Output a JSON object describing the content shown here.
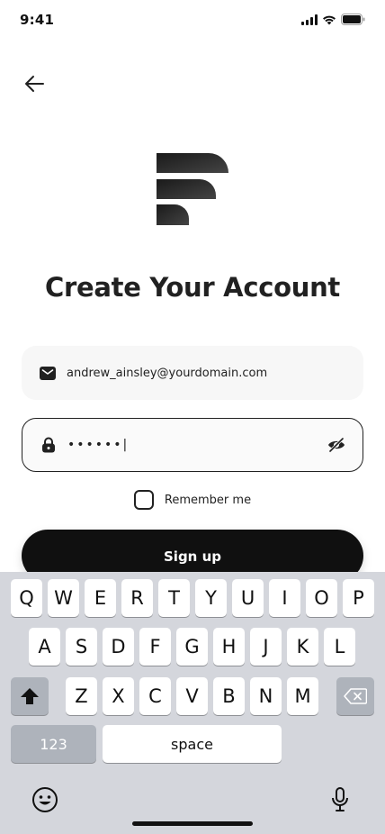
{
  "status_bar": {
    "time": "9:41"
  },
  "page": {
    "title": "Create Your Account"
  },
  "form": {
    "email_value": "andrew_ainsley@yourdomain.com",
    "password_value": "••••••|",
    "remember_label": "Remember me",
    "remember_checked": false,
    "signup_label": "Sign up"
  },
  "keyboard": {
    "row1": [
      "Q",
      "W",
      "E",
      "R",
      "T",
      "Y",
      "U",
      "I",
      "O",
      "P"
    ],
    "row2": [
      "A",
      "S",
      "D",
      "F",
      "G",
      "H",
      "J",
      "K",
      "L"
    ],
    "row3": [
      "Z",
      "X",
      "C",
      "V",
      "B",
      "N",
      "M"
    ],
    "numbers_label": "123",
    "space_label": "space"
  },
  "icons": {
    "back": "arrow-left-icon",
    "email": "mail-icon",
    "password": "lock-icon",
    "visibility": "eye-off-icon",
    "shift": "shift-icon",
    "backspace": "backspace-icon",
    "emoji": "emoji-icon",
    "mic": "microphone-icon"
  },
  "colors": {
    "primary": "#101010",
    "field_bg": "#f7f7f7",
    "keyboard_bg": "#d4d6dc"
  }
}
